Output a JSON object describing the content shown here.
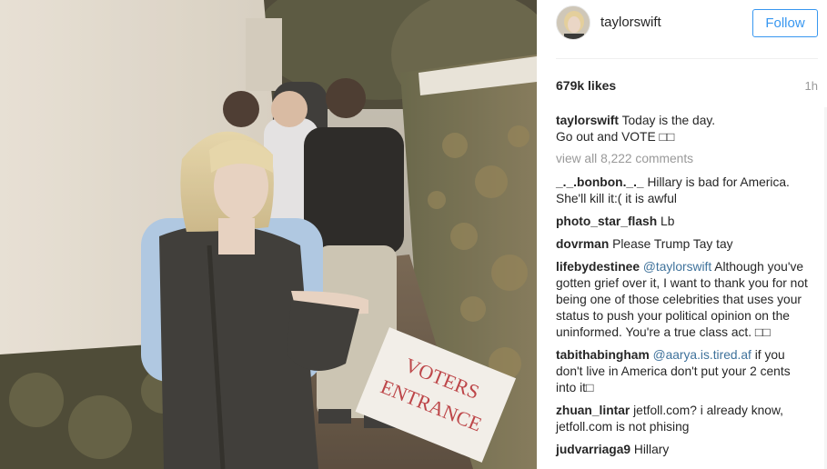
{
  "post": {
    "photo_sign_line1": "VOTERS",
    "photo_sign_line2": "ENTRANCE"
  },
  "header": {
    "username": "taylorswift",
    "follow_label": "Follow"
  },
  "stats": {
    "likes": "679k likes",
    "time": "1h"
  },
  "caption": {
    "user": "taylorswift",
    "line1": "Today is the day.",
    "line2": "Go out and VOTE □□"
  },
  "view_all": "view all 8,222 comments",
  "comments": [
    {
      "user": "_._.bonbon._._",
      "mention": "",
      "text": "Hillary is bad for America. She'll kill it:( it is awful"
    },
    {
      "user": "photo_star_flash",
      "mention": "",
      "text": "Lb"
    },
    {
      "user": "dovrman",
      "mention": "",
      "text": "Please Trump Tay tay"
    },
    {
      "user": "lifebydestinee",
      "mention": "@taylorswift",
      "text": "Although you've gotten grief over it, I want to thank you for not being one of those celebrities that uses your status to push your political opinion on the uninformed. You're a true class act. □□"
    },
    {
      "user": "tabithabingham",
      "mention": "@aarya.is.tired.af",
      "text": "if you don't live in America don't put your 2 cents into it□"
    },
    {
      "user": "zhuan_lintar",
      "mention": "",
      "text": "jetfoll.com? i already know, jetfoll.com is not phising"
    },
    {
      "user": "judvarriaga9",
      "mention": "",
      "text": "Hillary"
    }
  ],
  "colors": {
    "follow_blue": "#3897f0",
    "mention_blue": "#3f729b",
    "sign_red": "#b8333a"
  }
}
